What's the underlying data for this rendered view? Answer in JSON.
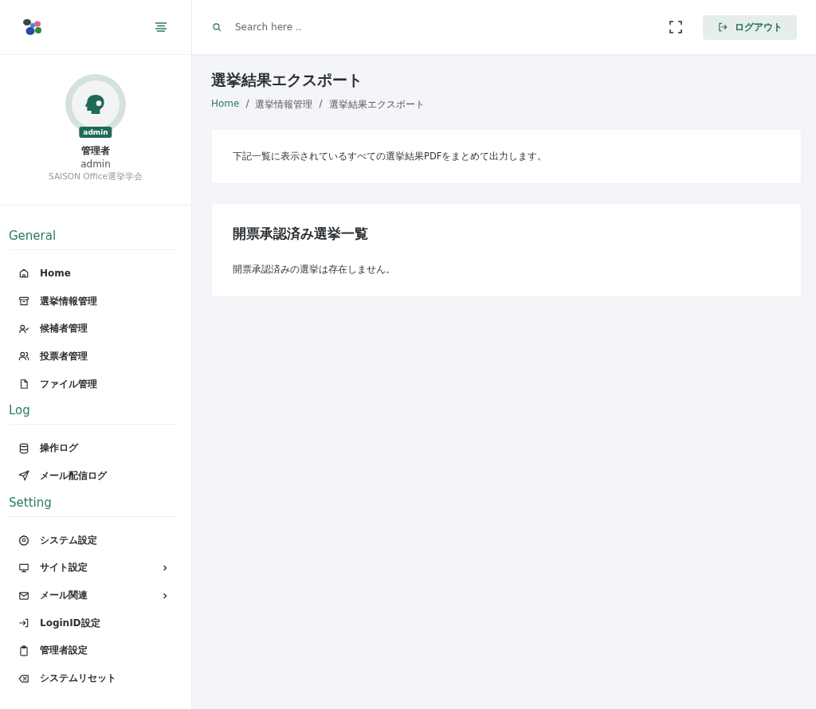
{
  "header": {
    "search": {
      "placeholder": "Search here .."
    },
    "logout_button": "ログアウト"
  },
  "profile": {
    "badge": "admin",
    "role": "管理者",
    "username": "admin",
    "organization": "SAISON Office選挙学会"
  },
  "sidebar": {
    "sections": [
      {
        "title": "General",
        "items": [
          {
            "label": "Home",
            "expandable": false
          },
          {
            "label": "選挙情報管理",
            "expandable": false
          },
          {
            "label": "候補者管理",
            "expandable": false
          },
          {
            "label": "投票者管理",
            "expandable": false
          },
          {
            "label": "ファイル管理",
            "expandable": false
          }
        ]
      },
      {
        "title": "Log",
        "items": [
          {
            "label": "操作ログ",
            "expandable": false
          },
          {
            "label": "メール配信ログ",
            "expandable": false
          }
        ]
      },
      {
        "title": "Setting",
        "items": [
          {
            "label": "システム設定",
            "expandable": false
          },
          {
            "label": "サイト設定",
            "expandable": true
          },
          {
            "label": "メール関連",
            "expandable": true
          },
          {
            "label": "LoginID設定",
            "expandable": false
          },
          {
            "label": "管理者設定",
            "expandable": false
          },
          {
            "label": "システムリセット",
            "expandable": false
          }
        ]
      }
    ]
  },
  "page": {
    "title": "選挙結果エクスポート",
    "breadcrumb": [
      {
        "kind": "link",
        "text": "Home"
      },
      {
        "kind": "separator",
        "text": "/"
      },
      {
        "kind": "link",
        "text": "選挙情報管理"
      },
      {
        "kind": "separator",
        "text": "/"
      },
      {
        "kind": "current",
        "text": "選挙結果エクスポート"
      }
    ]
  },
  "cards": [
    {
      "text": "下記一覧に表示されているすべての選挙結果PDFをまとめて出力します。"
    },
    {
      "heading": "開票承認済み選挙一覧",
      "text": "開票承認済みの選挙は存在しません。"
    }
  ]
}
